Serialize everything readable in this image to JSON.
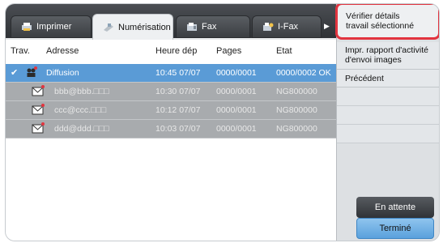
{
  "tabs": [
    {
      "label": "Imprimer",
      "icon": "printer-icon"
    },
    {
      "label": "Numérisation",
      "icon": "scanner-icon"
    },
    {
      "label": "Fax",
      "icon": "fax-icon"
    },
    {
      "label": "I-Fax",
      "icon": "ifax-icon"
    }
  ],
  "table": {
    "headers": [
      "Trav.",
      "Adresse",
      "Heure dép",
      "Pages",
      "Etat"
    ],
    "rows": [
      {
        "icon": "broadcast-icon",
        "address": "Diffusion",
        "time": "10:45 07/07",
        "pages": "0000/0001",
        "status": "0000/0002 OK"
      },
      {
        "icon": "envelope-icon",
        "address": "bbb@bbb.□□□",
        "time": "10:30 07/07",
        "pages": "0000/0001",
        "status": "NG800000"
      },
      {
        "icon": "envelope-icon",
        "address": "ccc@ccc.□□□",
        "time": "10:12 07/07",
        "pages": "0000/0001",
        "status": "NG800000"
      },
      {
        "icon": "envelope-icon",
        "address": "ddd@ddd.□□□",
        "time": "10:03 07/07",
        "pages": "0000/0001",
        "status": "NG800000"
      }
    ]
  },
  "side_menu": {
    "verify_line1": "Vérifier détails",
    "verify_line2": "travail sélectionné",
    "print_line1": "Impr. rapport d'activité",
    "print_line2": "d'envoi images",
    "previous": "Précédent"
  },
  "status_buttons": {
    "waiting": "En attente",
    "done": "Terminé"
  },
  "colors": {
    "accent_highlight": "#e2343f",
    "selected_row": "#5a9bd6",
    "done_button": "#5aa1dc"
  }
}
